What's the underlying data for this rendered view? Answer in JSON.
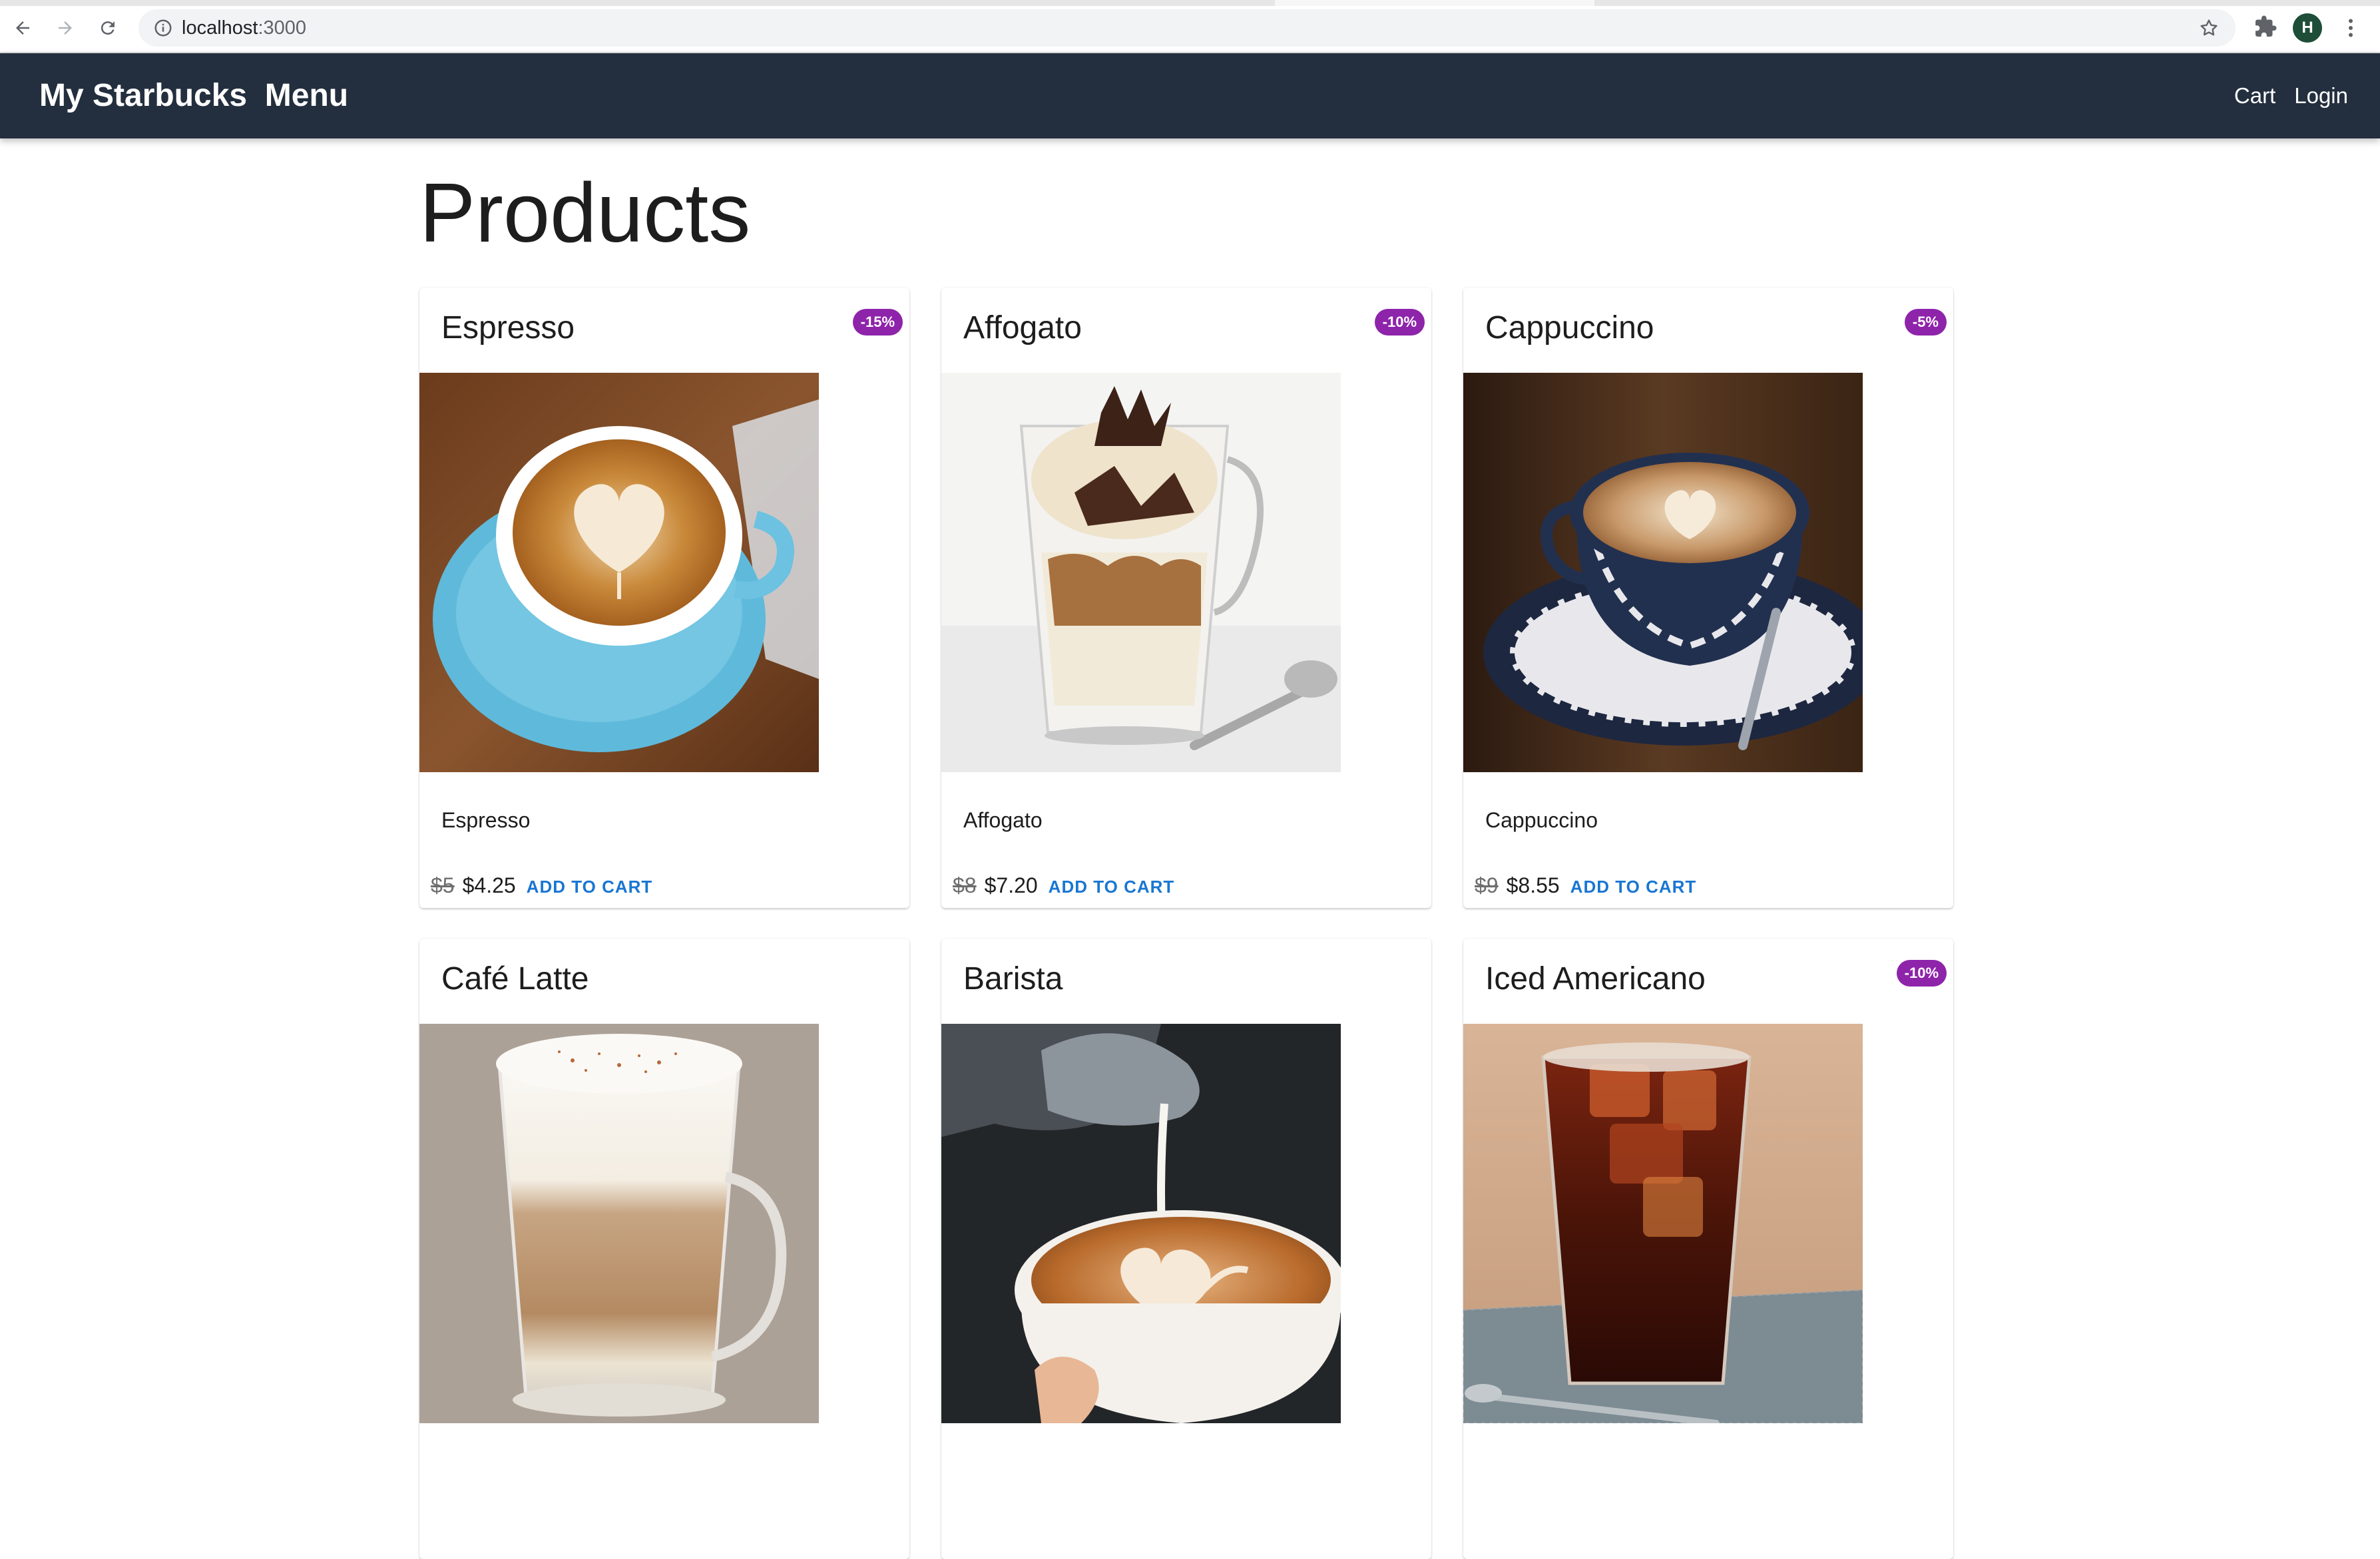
{
  "browser": {
    "url_host": "localhost",
    "url_port": ":3000",
    "profile_initial": "H"
  },
  "app": {
    "title": "My Starbucks  Menu",
    "nav": {
      "cart": "Cart",
      "login": "Login"
    }
  },
  "page": {
    "title": "Products"
  },
  "products": [
    {
      "name": "Espresso",
      "badge": "-15%",
      "description": "Espresso",
      "old_price": "$5",
      "price": "$4.25",
      "action": "ADD TO CART"
    },
    {
      "name": "Affogato",
      "badge": "-10%",
      "description": "Affogato",
      "old_price": "$8",
      "price": "$7.20",
      "action": "ADD TO CART"
    },
    {
      "name": "Cappuccino",
      "badge": "-5%",
      "description": "Cappuccino",
      "old_price": "$9",
      "price": "$8.55",
      "action": "ADD TO CART"
    },
    {
      "name": "Café Latte"
    },
    {
      "name": "Barista"
    },
    {
      "name": "Iced Americano",
      "badge": "-10%"
    }
  ],
  "colors": {
    "appbar": "#232f3e",
    "badge": "#8e24aa",
    "action": "#1976d2"
  }
}
